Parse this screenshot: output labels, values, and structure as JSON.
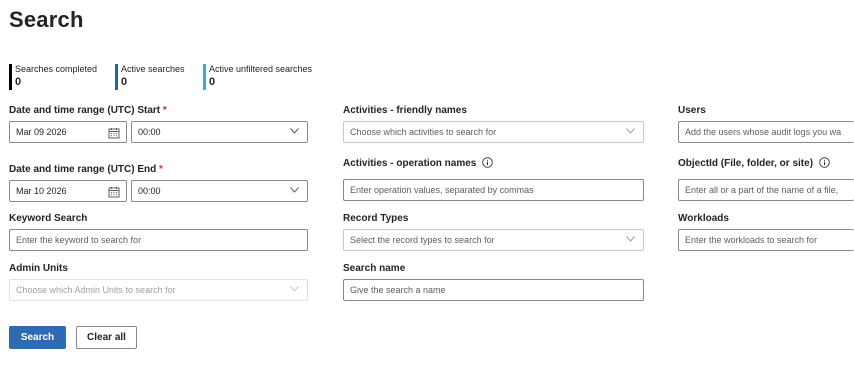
{
  "page": {
    "title": "Search"
  },
  "stats": [
    {
      "label": "Searches completed",
      "value": "0",
      "color": "#000000"
    },
    {
      "label": "Active searches",
      "value": "0",
      "color": "#2f5f98"
    },
    {
      "label": "Active unfiltered searches",
      "value": "0",
      "color": "#4aa0e6"
    }
  ],
  "form": {
    "start": {
      "label": "Date and time range (UTC) Start",
      "required_mark": "*",
      "date": "Mar 09 2026",
      "time": "00:00"
    },
    "end": {
      "label": "Date and time range (UTC) End",
      "required_mark": "*",
      "date": "Mar 10 2026",
      "time": "00:00"
    },
    "keyword": {
      "label": "Keyword Search",
      "placeholder": "Enter the keyword to search for"
    },
    "admin_units": {
      "label": "Admin Units",
      "placeholder": "Choose which Admin Units to search for"
    },
    "activities_friendly": {
      "label": "Activities - friendly names",
      "placeholder": "Choose which activities to search for"
    },
    "activities_operation": {
      "label": "Activities - operation names",
      "placeholder": "Enter operation values, separated by commas"
    },
    "record_types": {
      "label": "Record Types",
      "placeholder": "Select the record types to search for"
    },
    "search_name": {
      "label": "Search name",
      "placeholder": "Give the search a name"
    },
    "users": {
      "label": "Users",
      "placeholder": "Add the users whose audit logs you wa"
    },
    "object_id": {
      "label": "ObjectId (File, folder, or site)",
      "placeholder": "Enter all or a part of the name of a file,"
    },
    "workloads": {
      "label": "Workloads",
      "placeholder": "Enter the workloads to search for"
    }
  },
  "buttons": {
    "search": "Search",
    "clear_all": "Clear all"
  },
  "colors": {
    "primary": "#2f6ab3",
    "required": "#c4314b"
  }
}
